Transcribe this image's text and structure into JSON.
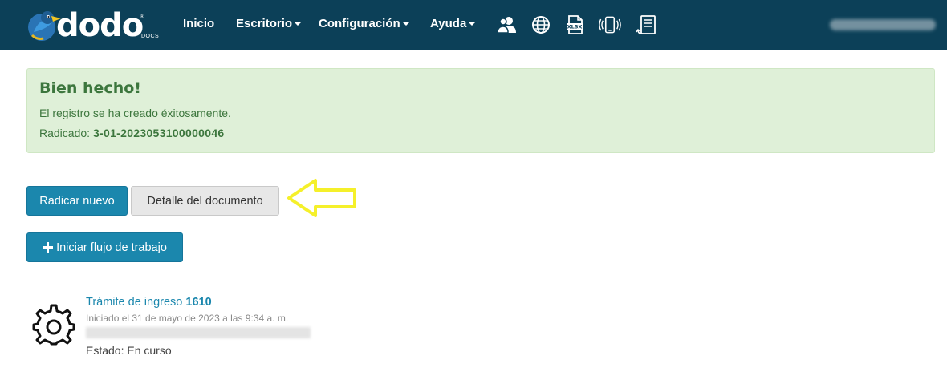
{
  "brand": {
    "name": "dodo",
    "sub": "DOCS",
    "reg": "®"
  },
  "nav": {
    "inicio": "Inicio",
    "escritorio": "Escritorio",
    "configuracion": "Configuración",
    "ayuda": "Ayuda",
    "icons": [
      "users-icon",
      "globe-icon",
      "xlsx-icon",
      "phone-vibrate-icon",
      "document-list-icon"
    ]
  },
  "alert": {
    "title": "Bien hecho!",
    "message": "El registro se ha creado éxitosamente.",
    "radicado_label": "Radicado:",
    "radicado_value": "3-01-2023053100000046"
  },
  "actions": {
    "radicar_nuevo": "Radicar nuevo",
    "detalle": "Detalle del documento",
    "iniciar_flujo": "Iniciar flujo de trabajo"
  },
  "process": {
    "title": "Trámite de ingreso",
    "number": "1610",
    "started": "Iniciado el 31 de mayo de 2023 a las 9:34 a. m.",
    "status": "Estado: En curso"
  },
  "colors": {
    "navbar": "#0c4058",
    "primary": "#1b87ad",
    "success_bg": "#dff0d8",
    "success_text": "#3c763d",
    "highlight_arrow": "#f5f02a"
  }
}
